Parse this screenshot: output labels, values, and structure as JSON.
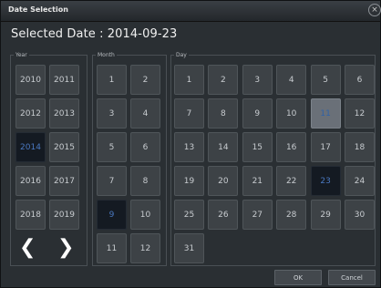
{
  "window": {
    "title": "Date Selection",
    "close_glyph": "×"
  },
  "selected_label": "Selected Date : 2014-09-23",
  "year": {
    "legend": "Year",
    "items": [
      "2010",
      "2011",
      "2012",
      "2013",
      "2014",
      "2015",
      "2016",
      "2017",
      "2018",
      "2019"
    ],
    "selected": "2014",
    "prev_glyph": "❮",
    "next_glyph": "❯"
  },
  "month": {
    "legend": "Month",
    "items": [
      "1",
      "2",
      "3",
      "4",
      "5",
      "6",
      "7",
      "8",
      "9",
      "10",
      "11",
      "12"
    ],
    "selected": "9"
  },
  "day": {
    "legend": "Day",
    "items": [
      "1",
      "2",
      "3",
      "4",
      "5",
      "6",
      "7",
      "8",
      "9",
      "10",
      "11",
      "12",
      "13",
      "14",
      "15",
      "16",
      "17",
      "18",
      "19",
      "20",
      "21",
      "22",
      "23",
      "24",
      "25",
      "26",
      "27",
      "28",
      "29",
      "30",
      "31"
    ],
    "selected": "23",
    "today": "11"
  },
  "buttons": {
    "ok": "OK",
    "cancel": "Cancel"
  },
  "colors": {
    "background": "#2a2f33",
    "cell": "#3d4246",
    "selected_text": "#4a78c0"
  }
}
